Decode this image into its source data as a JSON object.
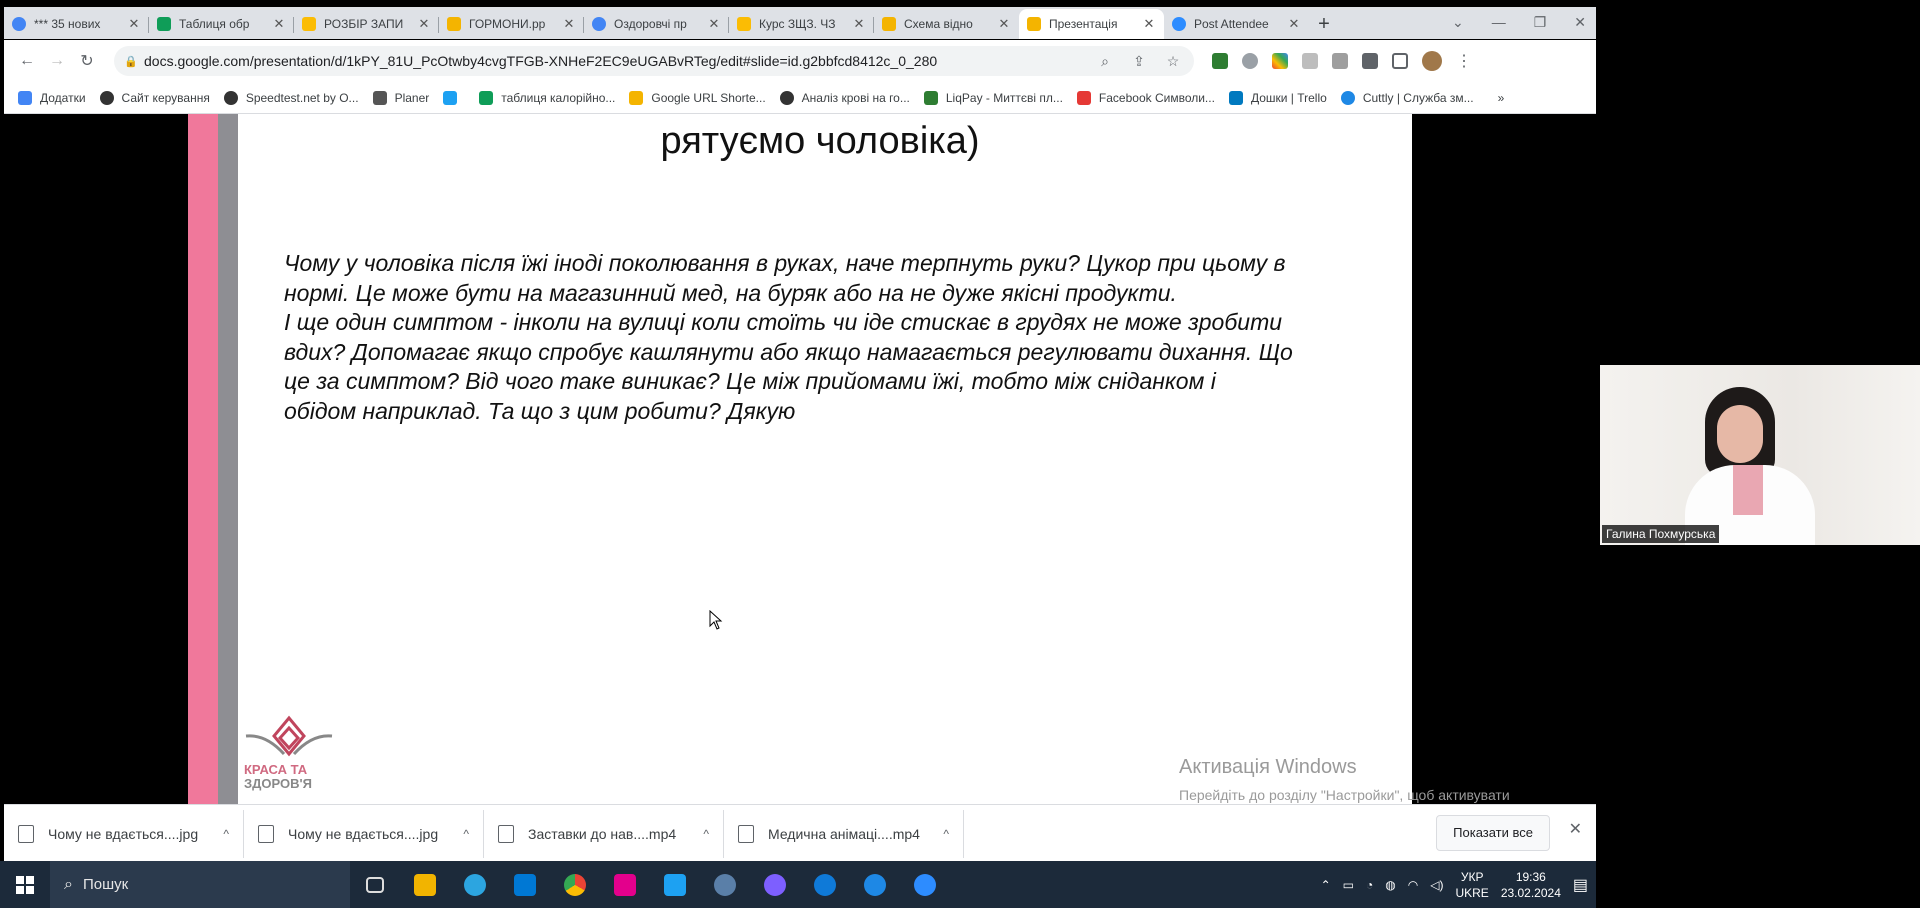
{
  "browser": {
    "tabs": [
      {
        "label": "*** 35 нових",
        "color": "#4285f4"
      },
      {
        "label": "Таблиця обр",
        "color": "#0f9d58"
      },
      {
        "label": "РОЗБІР ЗАПИ",
        "color": "#fbbc04"
      },
      {
        "label": "ГОРМОНИ.pp",
        "color": "#f4b400"
      },
      {
        "label": "Оздоровчі пр",
        "color": "#4285f4"
      },
      {
        "label": "Курс ЗЩЗ. ЧЗ",
        "color": "#fbbc04"
      },
      {
        "label": "Схема відно",
        "color": "#f4b400"
      },
      {
        "label": "Презентація",
        "color": "#f4b400",
        "active": true
      },
      {
        "label": "Post Attendee",
        "color": "#2d8cff"
      }
    ],
    "tab_close": "✕",
    "new_tab": "+",
    "url": "docs.google.com/presentation/d/1kPY_81U_PcOtwby4cvgTFGB-XNHeF2EC9eUGABvRTeg/edit#slide=id.g2bbfcd8412c_0_280",
    "bookmarks": [
      {
        "label": "Додатки",
        "color": "#4285f4"
      },
      {
        "label": "Сайт керування",
        "color": "#333333"
      },
      {
        "label": "Speedtest.net by O...",
        "color": "#333333"
      },
      {
        "label": "Planer",
        "color": "#555555"
      },
      {
        "label": "",
        "color": "#1da1f2"
      },
      {
        "label": "таблиця калорійно...",
        "color": "#0f9d58"
      },
      {
        "label": "Google URL Shorte...",
        "color": "#f4b400"
      },
      {
        "label": "Аналіз крові на го...",
        "color": "#333333"
      },
      {
        "label": "LiqPay - Миттєві пл...",
        "color": "#2e7d32"
      },
      {
        "label": "Facebook Символи...",
        "color": "#e53935"
      },
      {
        "label": "Дошки | Trello",
        "color": "#0079bf"
      },
      {
        "label": "Cuttly | Служба зм...",
        "color": "#1e88e5"
      }
    ],
    "bookmarks_more": "»"
  },
  "slide": {
    "title": "рятуємо чоловіка)",
    "paragraphs": [
      "Чому у чоловіка після їжі іноді поколювання в руках, наче терпнуть руки? Цукор при цьому в нормі. Це може бути на магазинний мед, на буряк або на не дуже якісні продукти.",
      " І ще один симптом - інколи на вулиці коли стоїть чи іде стискає в грудях не може зробити вдих? Допомагає якщо спробує кашлянути або якщо намагається регулювати дихання. Що це за симптом? Від чого таке виникає? Це між прийомами їжі, тобто між сніданком і обідом наприклад. Та що з цим робити? Дякую"
    ],
    "logo_line1": "КРАСА ТА",
    "logo_line2": "ЗДОРОВ'Я"
  },
  "activation": {
    "title": "Активація Windows",
    "subtitle": "Перейдіть до розділу \"Настройки\", щоб активувати Windows."
  },
  "downloads": {
    "items": [
      {
        "name": "Чому не вдається....jpg"
      },
      {
        "name": "Чому не вдається....jpg"
      },
      {
        "name": "Заставки до нав....mp4"
      },
      {
        "name": "Медична анімаці....mp4"
      }
    ],
    "chevron": "^",
    "show_all": "Показати все",
    "close": "✕"
  },
  "taskbar": {
    "search_placeholder": "Пошук",
    "lang_line1": "УКР",
    "lang_line2": "UKRE",
    "time": "19:36",
    "date": "23.02.2024",
    "apps": [
      "#cccccc",
      "#f2b400",
      "#2ca5e0",
      "#0078d4",
      "#ea4335",
      "#e3008c",
      "#1da1f2",
      "#5a7fa8",
      "#7d5fff",
      "#0f7ad8",
      "#1e88e5",
      "#2d8cff"
    ]
  },
  "webcam": {
    "name": "Галина Похмурська"
  }
}
